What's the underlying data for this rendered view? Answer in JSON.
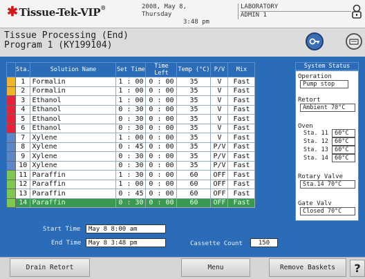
{
  "header": {
    "brand": "Tissue-Tek",
    "brand_suffix": "VIP",
    "datetime_line1": "2008, May 8, Thursday",
    "datetime_line2": "3:48 pm",
    "location_line1": "LABORATORY",
    "location_line2": "ADMIN 1",
    "icon_user": "user-icon"
  },
  "title": {
    "line1": "Tissue Processing (End)",
    "line2": "Program  1   (KY199104)",
    "icon_key": "key-icon",
    "icon_cassette": "cassette-icon"
  },
  "table": {
    "headers": [
      "Sta.",
      "Solution Name",
      "Set Time",
      "Time Left",
      "Temp (°C)",
      "P/V",
      "Mix"
    ],
    "rows": [
      {
        "sta": "1",
        "name": "Formalin",
        "set": "1 : 00",
        "left": "0 : 00",
        "temp": "35",
        "pv": "V",
        "mix": "Fast",
        "color": "#f0b429"
      },
      {
        "sta": "2",
        "name": "Formalin",
        "set": "1 : 00",
        "left": "0 : 00",
        "temp": "35",
        "pv": "V",
        "mix": "Fast",
        "color": "#f0b429"
      },
      {
        "sta": "3",
        "name": "Ethanol",
        "set": "1 : 00",
        "left": "0 : 00",
        "temp": "35",
        "pv": "V",
        "mix": "Fast",
        "color": "#e5243b"
      },
      {
        "sta": "4",
        "name": "Ethanol",
        "set": "0 : 30",
        "left": "0 : 00",
        "temp": "35",
        "pv": "V",
        "mix": "Fast",
        "color": "#e5243b"
      },
      {
        "sta": "5",
        "name": "Ethanol",
        "set": "0 : 30",
        "left": "0 : 00",
        "temp": "35",
        "pv": "V",
        "mix": "Fast",
        "color": "#e5243b"
      },
      {
        "sta": "6",
        "name": "Ethanol",
        "set": "0 : 30",
        "left": "0 : 00",
        "temp": "35",
        "pv": "V",
        "mix": "Fast",
        "color": "#e5243b"
      },
      {
        "sta": "7",
        "name": "Xylene",
        "set": "1 : 00",
        "left": "0 : 00",
        "temp": "35",
        "pv": "V",
        "mix": "Fast",
        "color": "#5b86c8"
      },
      {
        "sta": "8",
        "name": "Xylene",
        "set": "0 : 45",
        "left": "0 : 00",
        "temp": "35",
        "pv": "P/V",
        "mix": "Fast",
        "color": "#5b86c8"
      },
      {
        "sta": "9",
        "name": "Xylene",
        "set": "0 : 30",
        "left": "0 : 00",
        "temp": "35",
        "pv": "P/V",
        "mix": "Fast",
        "color": "#5b86c8"
      },
      {
        "sta": "10",
        "name": "Xylene",
        "set": "0 : 30",
        "left": "0 : 00",
        "temp": "35",
        "pv": "P/V",
        "mix": "Fast",
        "color": "#5b86c8"
      },
      {
        "sta": "11",
        "name": "Paraffin",
        "set": "1 : 30",
        "left": "0 : 00",
        "temp": "60",
        "pv": "OFF",
        "mix": "Fast",
        "color": "#7ec850"
      },
      {
        "sta": "12",
        "name": "Paraffin",
        "set": "1 : 00",
        "left": "0 : 00",
        "temp": "60",
        "pv": "OFF",
        "mix": "Fast",
        "color": "#7ec850"
      },
      {
        "sta": "13",
        "name": "Paraffin",
        "set": "0 : 45",
        "left": "0 : 00",
        "temp": "60",
        "pv": "OFF",
        "mix": "Fast",
        "color": "#7ec850"
      },
      {
        "sta": "14",
        "name": "Paraffin",
        "set": "0 : 30",
        "left": "0 : 00",
        "temp": "60",
        "pv": "OFF",
        "mix": "Fast",
        "color": "#7ec850",
        "active": true
      }
    ]
  },
  "status": {
    "heading": "System Status",
    "operation_label": "Operation",
    "operation_value": "Pump stop",
    "retort_label": "Retort",
    "retort_value": "Ambient 70°C",
    "oven_label": "Oven",
    "oven": [
      {
        "label": "Sta. 11",
        "value": "60°C"
      },
      {
        "label": "Sta. 12",
        "value": "60°C"
      },
      {
        "label": "Sta. 13",
        "value": "60°C"
      },
      {
        "label": "Sta. 14",
        "value": "60°C"
      }
    ],
    "rotary_label": "Rotary Valve",
    "rotary_value": "Sta.14 70°C",
    "gate_label": "Gate Valv",
    "gate_value": "Closed 70°C"
  },
  "times": {
    "start_label": "Start Time",
    "start_value": "May 8  8:00  am",
    "end_label": "End Time",
    "end_value": "May 8  3:48  pm",
    "cassette_label": "Cassette Count",
    "cassette_value": "150"
  },
  "buttons": {
    "drain": "Drain Retort",
    "menu": "Menu",
    "remove": "Remove Baskets",
    "help": "?"
  },
  "colors": {
    "panel_blue": "#2a6cb8",
    "active_row": "#3a9a52"
  }
}
